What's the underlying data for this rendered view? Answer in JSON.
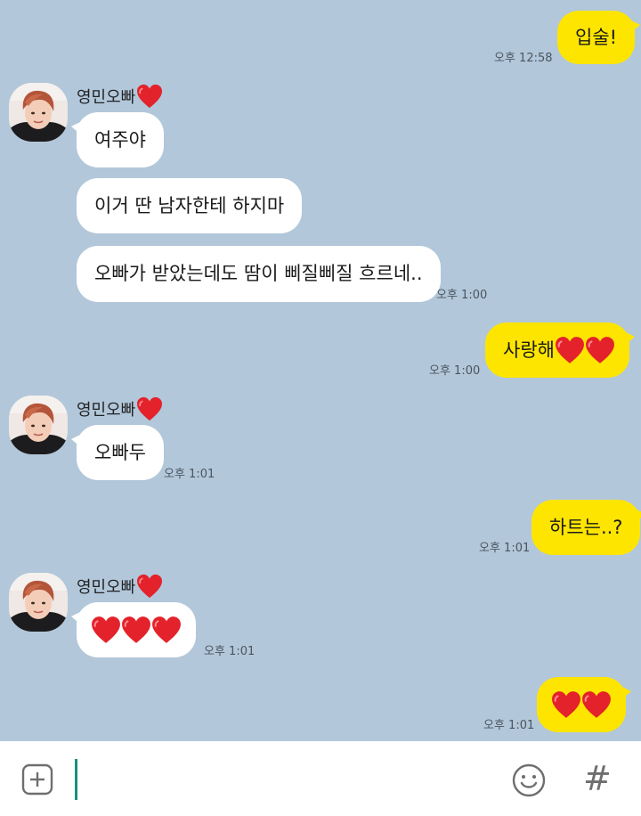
{
  "colors": {
    "background": "#b2c7da",
    "incoming_bubble": "#ffffff",
    "outgoing_bubble": "#fee500",
    "cursor": "#1a8f80",
    "heart": "#e3222b"
  },
  "sender": {
    "name": "영민오빠",
    "icon": "red-heart-icon"
  },
  "messages": [
    {
      "dir": "out",
      "text": "입술!",
      "time": "오후 12:58"
    },
    {
      "dir": "in",
      "text": "여주야"
    },
    {
      "dir": "in",
      "text": "이거 딴 남자한테 하지마"
    },
    {
      "dir": "in",
      "text": "오빠가 받았는데도 땀이 삐질삐질 흐르네..",
      "time": "오후 1:00"
    },
    {
      "dir": "out",
      "text": "사랑해",
      "hearts": 2,
      "time": "오후 1:00"
    },
    {
      "dir": "in",
      "text": "오빠두",
      "time": "오후 1:01"
    },
    {
      "dir": "out",
      "text": "하트는..?",
      "time": "오후 1:01"
    },
    {
      "dir": "in",
      "text": "",
      "hearts": 3,
      "time": "오후 1:01"
    },
    {
      "dir": "out",
      "text": "",
      "hearts": 2,
      "time": "오후 1:01"
    }
  ],
  "input": {
    "value": "",
    "plus_icon": "plus-square-icon",
    "emoji_icon": "smiley-icon",
    "hash_label": "#"
  }
}
